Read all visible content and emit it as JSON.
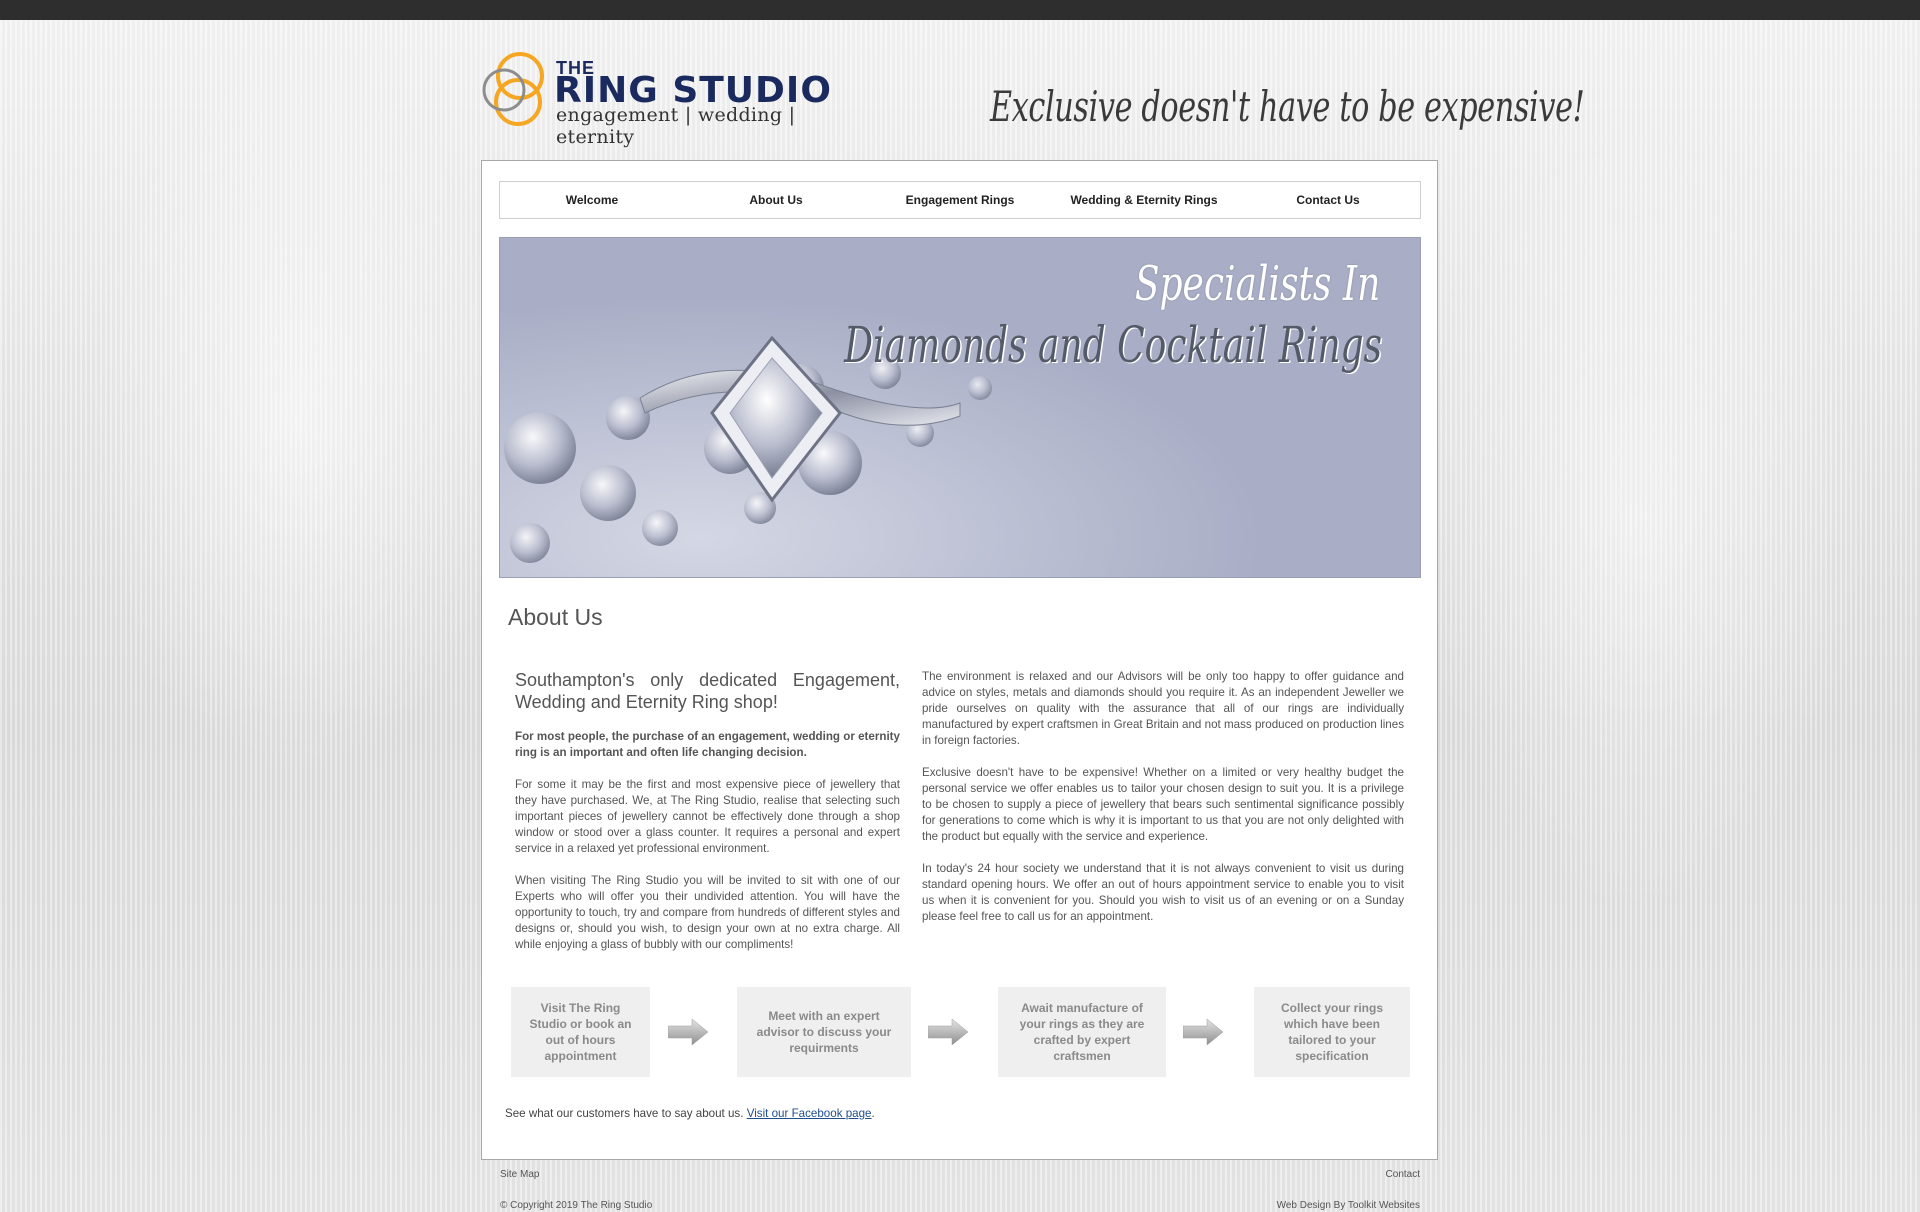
{
  "brand": {
    "the": "THE",
    "name": "RING STUDIO",
    "tagline": "engagement | wedding | eternity",
    "slogan": "Exclusive doesn't have to be expensive!"
  },
  "nav": [
    {
      "label": "Welcome"
    },
    {
      "label": "About Us"
    },
    {
      "label": "Engagement Rings"
    },
    {
      "label": "Wedding & Eternity Rings"
    },
    {
      "label": "Contact Us"
    }
  ],
  "banner": {
    "line1": "Specialists In",
    "line2": "Diamonds and Cocktail Rings"
  },
  "page": {
    "title": "About Us"
  },
  "left_column": {
    "lead": "Southampton's only dedicated Engagement, Wedding and Eternity Ring shop!",
    "bold": "For most people, the purchase of an engagement, wedding or eternity ring is an important and often life changing decision.",
    "p1": "For some it may be the first and most expensive piece of jewellery that they have purchased. We, at The Ring Studio, realise that selecting such important pieces of jewellery cannot be effectively done through a shop window or stood over a glass counter. It requires a personal and expert service in a relaxed yet professional environment.",
    "p2": "When visiting The Ring Studio you will be invited to sit with one of our Experts who will offer you their undivided attention. You will have the opportunity to touch, try and compare from hundreds of different styles and designs or, should you wish, to design your own at no extra charge. All while enjoying a glass of bubbly with our compliments!"
  },
  "right_column": {
    "p1": "The environment is relaxed and our Advisors will be only too happy to offer guidance and advice on styles, metals and diamonds should you require it. As an independent Jeweller we pride ourselves on quality with the assurance that all of our rings are individually manufactured by expert craftsmen in Great Britain and not mass produced on production lines in foreign factories.",
    "p2": "Exclusive doesn't have to be expensive! Whether on a limited or very healthy budget the personal service we offer enables us to tailor your chosen design to suit you. It is a privilege to be chosen to supply a piece of jewellery that bears such sentimental significance possibly for generations to come which is why it is important to us that you are not only delighted with the product but equally with the service and experience.",
    "p3": "In today's 24 hour society we understand that it is not always convenient to visit us during standard opening hours. We offer an out of hours appointment service to enable you to visit us when it is convenient for you. Should you wish to visit us of an evening or on a Sunday please feel free to call us for an appointment."
  },
  "steps": [
    {
      "label": "Visit The Ring Studio or book an out of hours appointment"
    },
    {
      "label": "Meet with an expert advisor to discuss your requirments"
    },
    {
      "label": "Await manufacture of your rings as they are crafted by expert craftsmen"
    },
    {
      "label": "Collect your rings which have been tailored to your specification"
    }
  ],
  "facebook": {
    "text": "See what our customers have to say about us.",
    "link": "Visit our Facebook page",
    "after": "."
  },
  "footer": {
    "sitemap": "Site Map",
    "contact": "Contact",
    "copyright": "© Copyright 2019 The Ring Studio",
    "credit": "Web Design By Toolkit Websites"
  },
  "colors": {
    "topbar": "#2e2e2e",
    "brand_navy": "#1b2a5e",
    "brand_orange": "#f5a623",
    "link": "#1f4e8c",
    "step_bg": "#efefef"
  }
}
